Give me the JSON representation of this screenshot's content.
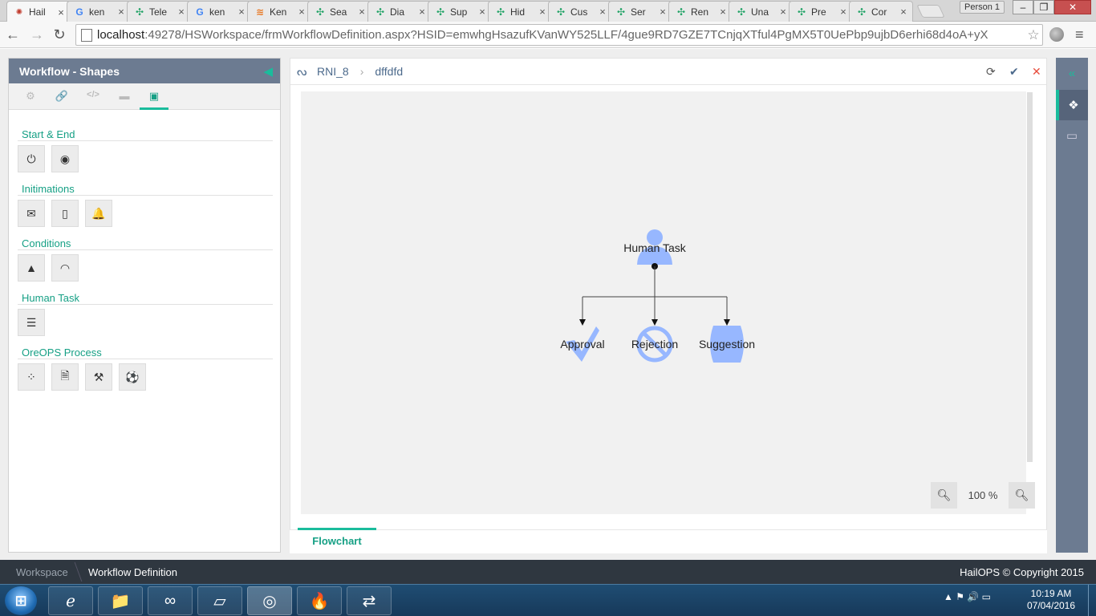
{
  "browser": {
    "tabs": [
      {
        "title": "Hail",
        "favicon": "hailops-icon",
        "active": true
      },
      {
        "title": "ken",
        "favicon": "google-icon"
      },
      {
        "title": "Tele",
        "favicon": "kendo-icon"
      },
      {
        "title": "ken",
        "favicon": "google-icon"
      },
      {
        "title": "Ken",
        "favicon": "stackoverflow-icon"
      },
      {
        "title": "Sea",
        "favicon": "kendo-icon"
      },
      {
        "title": "Dia",
        "favicon": "kendo-icon"
      },
      {
        "title": "Sup",
        "favicon": "kendo-icon"
      },
      {
        "title": "Hid",
        "favicon": "kendo-icon"
      },
      {
        "title": "Cus",
        "favicon": "kendo-icon"
      },
      {
        "title": "Ser",
        "favicon": "kendo-icon"
      },
      {
        "title": "Ren",
        "favicon": "kendo-icon"
      },
      {
        "title": "Una",
        "favicon": "kendo-icon"
      },
      {
        "title": "Pre",
        "favicon": "kendo-icon"
      },
      {
        "title": "Cor",
        "favicon": "kendo-icon"
      }
    ],
    "profile": "Person 1",
    "url_host": "localhost",
    "url_path": ":49278/HSWorkspace/frmWorkflowDefinition.aspx?HSID=emwhgHsazufKVanWY525LLF/4gue9RD7GZE7TCnjqXTful4PgMX5T0UePbp9ujbD6erhi68d4oA+yX"
  },
  "left_panel": {
    "title": "Workflow - Shapes",
    "sections": [
      {
        "title": "Start & End",
        "shapes": [
          "power-icon",
          "target-icon"
        ]
      },
      {
        "title": "Initimations",
        "shapes": [
          "envelope-icon",
          "mobile-icon",
          "bell-icon"
        ]
      },
      {
        "title": "Conditions",
        "shapes": [
          "warning-icon",
          "wifi-icon"
        ]
      },
      {
        "title": "Human Task",
        "shapes": [
          "list-icon"
        ]
      },
      {
        "title": "OreOPS Process",
        "shapes": [
          "spinner-icon",
          "pdf-icon",
          "gavel-icon",
          "ball-icon"
        ]
      }
    ]
  },
  "canvas_panel": {
    "breadcrumb_root": "RNI_8",
    "breadcrumb_current": "dffdfd",
    "diagram": {
      "nodes": [
        {
          "id": "human",
          "label": "Human Task",
          "icon": "user-icon"
        },
        {
          "id": "approval",
          "label": "Approval",
          "icon": "checkmark-icon"
        },
        {
          "id": "rejection",
          "label": "Rejection",
          "icon": "ban-icon"
        },
        {
          "id": "suggestion",
          "label": "Suggestion",
          "icon": "rounded-shape-icon"
        }
      ],
      "shape_color": "#97b7ff"
    },
    "zoom": "100 %",
    "bottom_tab": "Flowchart"
  },
  "footer": {
    "crumb_root": "Workspace",
    "crumb_current": "Workflow Definition",
    "copyright": "HailOPS © Copyright 2015"
  },
  "taskbar": {
    "time": "10:19 AM",
    "date": "07/04/2016"
  },
  "colors": {
    "accent": "#1abc9c",
    "panel_header": "#6c7b91",
    "footer": "#2f3740",
    "danger": "#e74c3c"
  }
}
